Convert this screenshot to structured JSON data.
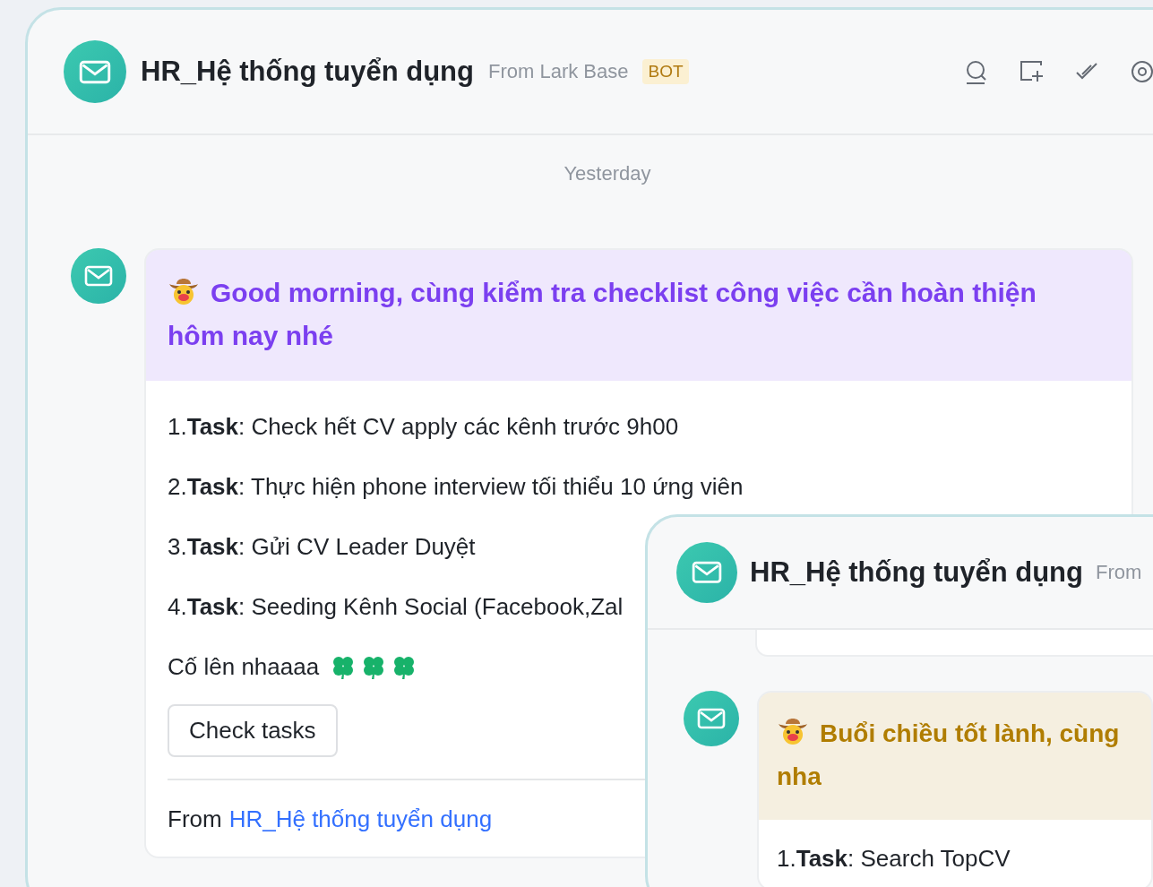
{
  "chat": {
    "title": "HR_Hệ thống tuyển dụng",
    "source": "From Lark Base",
    "badge": "BOT"
  },
  "date_divider": "Yesterday",
  "message": {
    "color": "#7b3ff0",
    "title": "Good morning, cùng kiểm tra checklist công việc cần hoàn thiện hôm nay nhé",
    "tasks": [
      "1.**Task**: Check hết CV apply các kênh trước 9h00",
      "2.**Task**: Thực hiện phone interview tối thiểu 10 ứng viên",
      "3.**Task**: Gửi CV Leader Duyệt",
      "4.**Task**: Seeding Kênh Social (Facebook,Zal"
    ],
    "cheer": "Cố lên nhaaaa",
    "button": "Check tasks",
    "footer_prefix": "From",
    "footer_link": "HR_Hệ thống tuyển dụng"
  },
  "overlay": {
    "title": "HR_Hệ thống tuyển dụng",
    "source": "From",
    "message": {
      "color": "#b07d00",
      "title": "Buổi chiều tốt lành, cùng",
      "title_line_2": "nha",
      "tasks": [
        "1.**Task**: Search TopCV"
      ]
    }
  }
}
